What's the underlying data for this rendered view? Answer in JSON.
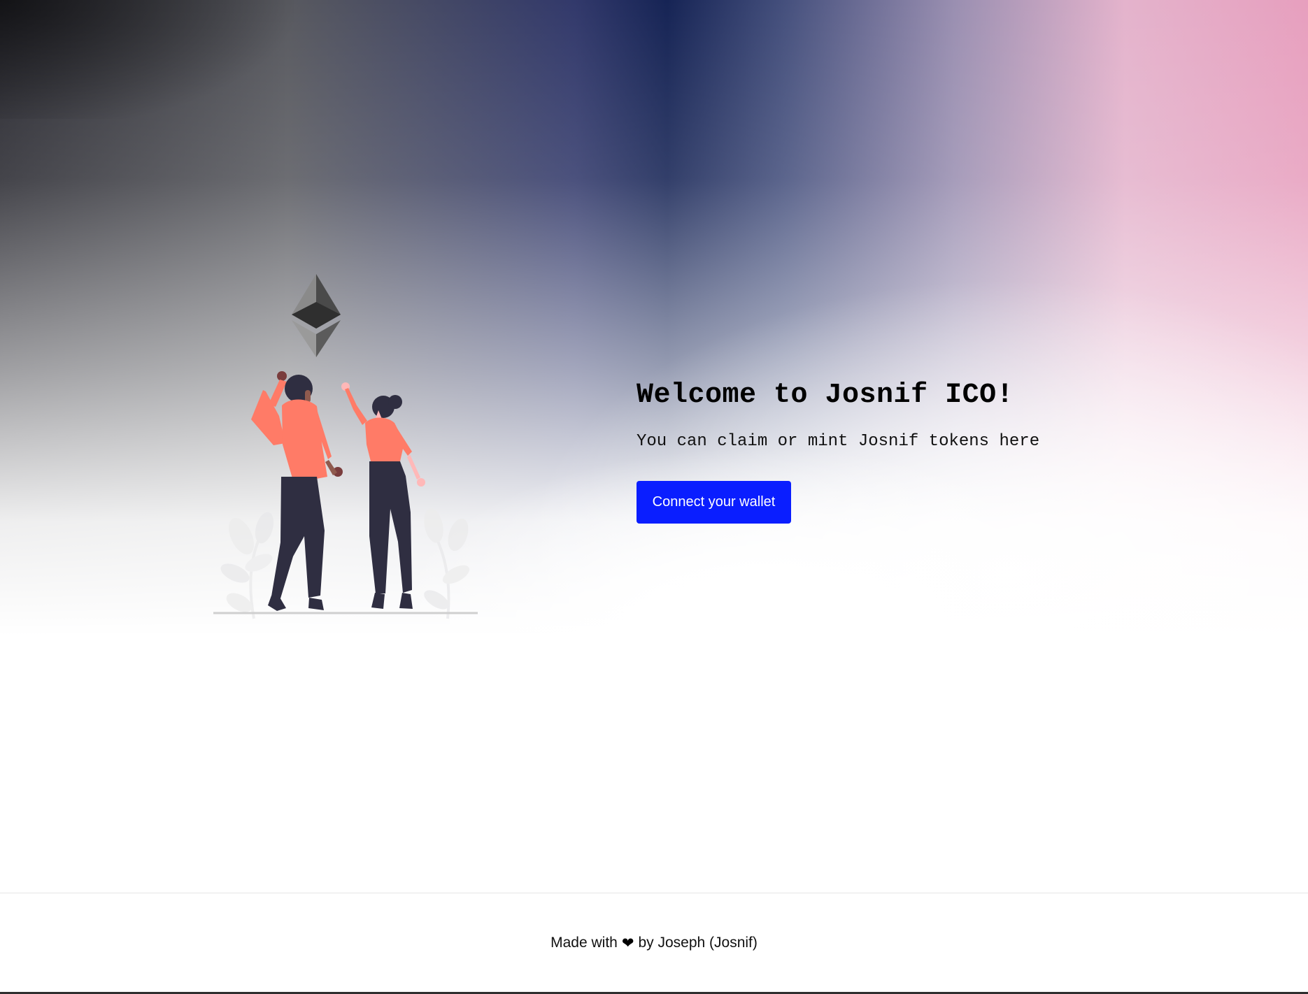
{
  "hero": {
    "title": "Welcome to Josnif ICO!",
    "subtitle": "You can claim or mint Josnif tokens here",
    "connect_label": "Connect your wallet",
    "accent_color": "#0a1eff",
    "illustration_icons": [
      "ethereum-logo-icon",
      "celebrating-people-illustration"
    ]
  },
  "footer": {
    "prefix": "Made with",
    "heart_icon": "❤",
    "suffix": "by Joseph (Josnif)"
  }
}
